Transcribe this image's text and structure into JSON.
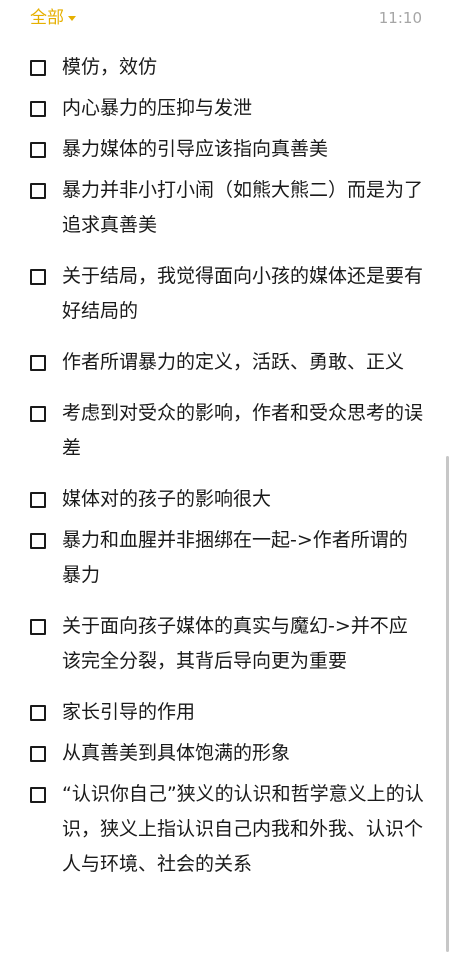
{
  "header": {
    "filter_label": "全部",
    "time": "11:10"
  },
  "tasks": [
    {
      "text": "模仿，效仿"
    },
    {
      "text": "内心暴力的压抑与发泄"
    },
    {
      "text": "暴力媒体的引导应该指向真善美"
    },
    {
      "text": "暴力并非小打小闹（如熊大熊二）而是为了追求真善美"
    },
    {
      "text": "关于结局，我觉得面向小孩的媒体还是要有好结局的"
    },
    {
      "text": "作者所谓暴力的定义，活跃、勇敢、正义"
    },
    {
      "text": "考虑到对受众的影响，作者和受众思考的误差"
    },
    {
      "text": "媒体对的孩子的影响很大"
    },
    {
      "text": "暴力和血腥并非捆绑在一起->作者所谓的暴力"
    },
    {
      "text": "关于面向孩子媒体的真实与魔幻->并不应该完全分裂，其背后导向更为重要"
    },
    {
      "text": "家长引导的作用"
    },
    {
      "text": "从真善美到具体饱满的形象"
    },
    {
      "text": "“认识你自己”狭义的认识和哲学意义上的认识，狭义上指认识自己内我和外我、认识个人与环境、社会的关系"
    }
  ],
  "colors": {
    "accent": "#e6b000",
    "text": "#1a1a1a",
    "time": "#a6a6a6"
  }
}
